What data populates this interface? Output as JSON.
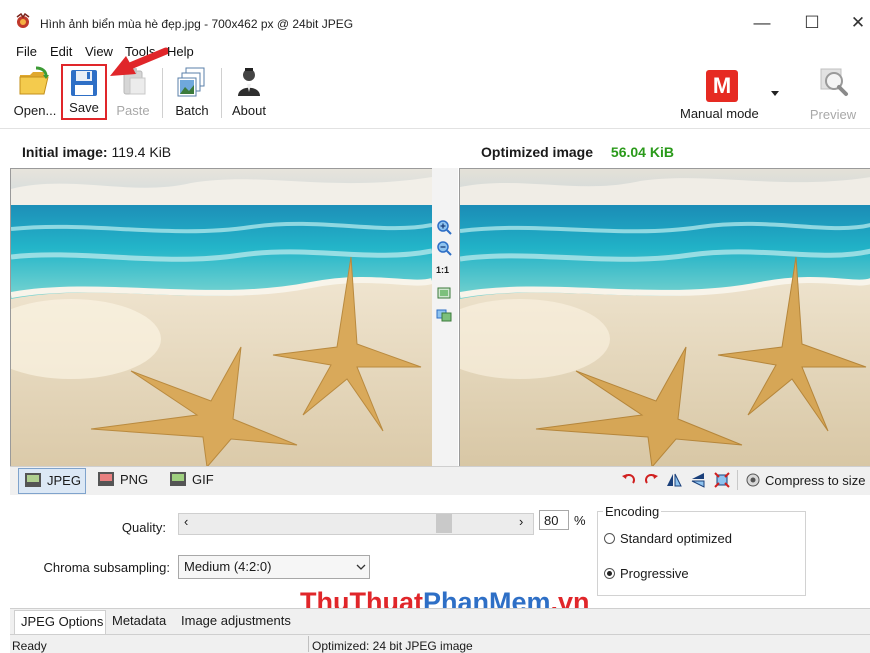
{
  "window": {
    "title": "Hình ảnh biển mùa hè đẹp.jpg - 700x462 px @ 24bit JPEG",
    "minimize_glyph": "—",
    "maximize_glyph": "☐",
    "close_glyph": "✕"
  },
  "menu": [
    "File",
    "Edit",
    "View",
    "Tools",
    "Help"
  ],
  "toolbar": {
    "open_label": "Open...",
    "save_label": "Save",
    "paste_label": "Paste",
    "batch_label": "Batch",
    "about_label": "About",
    "mode_badge": "M",
    "mode_label": "Manual mode",
    "preview_label": "Preview"
  },
  "images": {
    "initial_label": "Initial image:",
    "initial_size": "119.4 KiB",
    "optimized_label": "Optimized image",
    "optimized_size": "56.04 KiB",
    "zoom_actual_label": "1:1"
  },
  "formats": {
    "tabs": [
      {
        "label": "JPEG",
        "icon": "jpeg-file-icon",
        "selected": true
      },
      {
        "label": "PNG",
        "icon": "png-file-icon",
        "selected": false
      },
      {
        "label": "GIF",
        "icon": "gif-file-icon",
        "selected": false
      }
    ],
    "compress_label": "Compress to size"
  },
  "options": {
    "quality_label": "Quality:",
    "quality_value": "80",
    "quality_unit": "%",
    "quality_level": 0.8,
    "chroma_label": "Chroma subsampling:",
    "chroma_value": "Medium (4:2:0)",
    "encoding_label": "Encoding",
    "encoding_options": [
      "Standard optimized",
      "Progressive"
    ],
    "encoding_selected": "Progressive"
  },
  "bottom_tabs": [
    "JPEG Options",
    "Metadata",
    "Image adjustments"
  ],
  "watermark": {
    "part1": "ThuThuat",
    "part2": "PhanMem",
    "part3": ".vn"
  },
  "status": {
    "left": "Ready",
    "right": "Optimized: 24 bit JPEG image"
  },
  "colors": {
    "accent_highlight": "#e0262a",
    "optimized_size": "#2a9a1a",
    "mode_badge": "#e62a22"
  }
}
